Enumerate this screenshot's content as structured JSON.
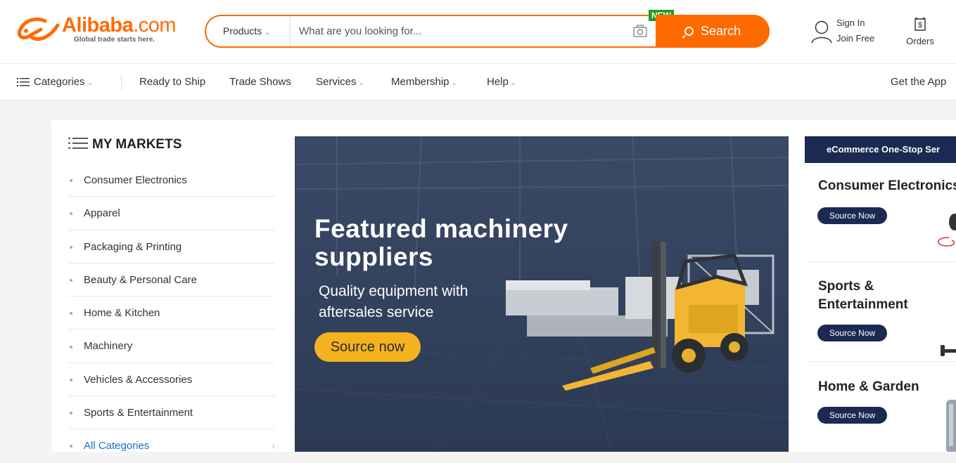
{
  "header": {
    "logo_name": "Alibaba",
    "logo_domain": ".com",
    "logo_tagline": "Global trade starts here.",
    "search": {
      "category": "Products",
      "placeholder": "What are you looking for...",
      "button_label": "Search",
      "new_badge": "NEW"
    },
    "sign_in": "Sign In",
    "join_free": "Join Free",
    "orders": "Orders"
  },
  "nav": {
    "categories": "Categories",
    "ready_to_ship": "Ready to Ship",
    "trade_shows": "Trade Shows",
    "services": "Services",
    "membership": "Membership",
    "help": "Help",
    "get_app": "Get the App"
  },
  "markets": {
    "title": "MY MARKETS",
    "items": [
      "Consumer Electronics",
      "Apparel",
      "Packaging & Printing",
      "Beauty & Personal Care",
      "Home & Kitchen",
      "Machinery",
      "Vehicles & Accessories",
      "Sports & Entertainment",
      "All Categories"
    ]
  },
  "banner": {
    "headline_line1": "Featured machinery",
    "headline_line2": "suppliers",
    "sub_line1": "Quality equipment with",
    "sub_line2": "aftersales service",
    "cta": "Source now"
  },
  "side": {
    "header": "eCommerce One-Stop Ser",
    "cards": [
      {
        "title": "Consumer Electronics",
        "button": "Source Now"
      },
      {
        "title_line1": "Sports &",
        "title_line2": "Entertainment",
        "button": "Source Now"
      },
      {
        "title": "Home & Garden",
        "button": "Source Now"
      }
    ]
  },
  "colors": {
    "brand_orange": "#ff6a00",
    "navy": "#1b2a52",
    "cta_yellow": "#f5b21f",
    "new_green": "#1e9c1e"
  }
}
